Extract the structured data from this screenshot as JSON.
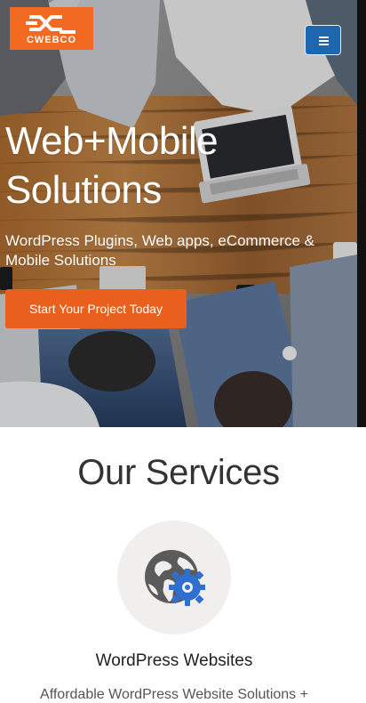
{
  "brand": {
    "logo_text": "CWEBCO",
    "colors": {
      "primary": "#f26a21",
      "button": "#e95f1d",
      "menu": "#1f66b0"
    }
  },
  "header": {
    "menu_icon": "hamburger-menu-icon"
  },
  "hero": {
    "title": "Web+Mobile Solutions",
    "subtitle": "WordPress Plugins, Web apps, eCommerce & Mobile Solutions",
    "cta_label": "Start Your Project Today"
  },
  "services": {
    "title": "Our Services",
    "items": [
      {
        "icon": "globe-gear-icon",
        "title": "WordPress Websites",
        "description": "Affordable WordPress Website Solutions +"
      }
    ]
  }
}
